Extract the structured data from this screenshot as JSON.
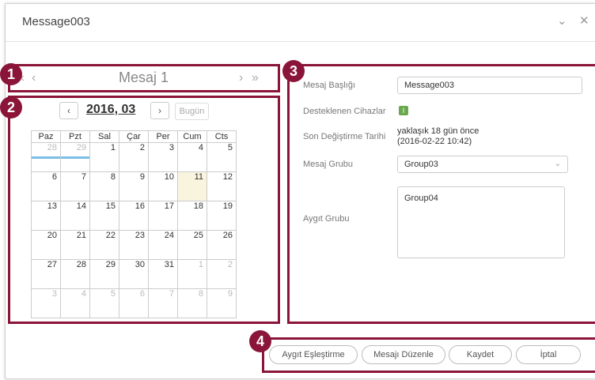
{
  "window": {
    "title": "Message003"
  },
  "nav": {
    "title": "Mesaj 1",
    "first": "«",
    "prev": "‹",
    "next": "›",
    "last": "»"
  },
  "calendar": {
    "month_label": "2016, 03",
    "today_label": "Bugün",
    "prev": "‹",
    "next": "›",
    "weekdays": [
      "Paz",
      "Pzt",
      "Sal",
      "Çar",
      "Per",
      "Cum",
      "Cts"
    ],
    "weeks": [
      [
        "28",
        "29",
        "1",
        "2",
        "3",
        "4",
        "5"
      ],
      [
        "6",
        "7",
        "8",
        "9",
        "10",
        "11",
        "12"
      ],
      [
        "13",
        "14",
        "15",
        "16",
        "17",
        "18",
        "19"
      ],
      [
        "20",
        "21",
        "22",
        "23",
        "24",
        "25",
        "26"
      ],
      [
        "27",
        "28",
        "29",
        "30",
        "31",
        "1",
        "2"
      ],
      [
        "3",
        "4",
        "5",
        "6",
        "7",
        "8",
        "9"
      ]
    ],
    "today": "11"
  },
  "form": {
    "title_label": "Mesaj Başlığı",
    "title_value": "Message003",
    "devices_label": "Desteklenen Cihazlar",
    "devices_badge": "I",
    "modified_label": "Son Değiştirme Tarihi",
    "modified_value_1": "yaklaşık 18 gün önce",
    "modified_value_2": "(2016-02-22 10:42)",
    "group_label": "Mesaj Grubu",
    "group_value": "Group03",
    "device_group_label": "Aygıt Grubu",
    "device_group_value": "Group04"
  },
  "actions": {
    "pair": "Aygıt Eşleştirme",
    "edit": "Mesajı Düzenle",
    "save": "Kaydet",
    "cancel": "İptal"
  },
  "callouts": [
    "1",
    "2",
    "3",
    "4"
  ],
  "colors": {
    "callout": "#8a1538",
    "today": "#f8f4dd",
    "event_bar": "#7bbfe6",
    "check": "#6aa84f"
  }
}
